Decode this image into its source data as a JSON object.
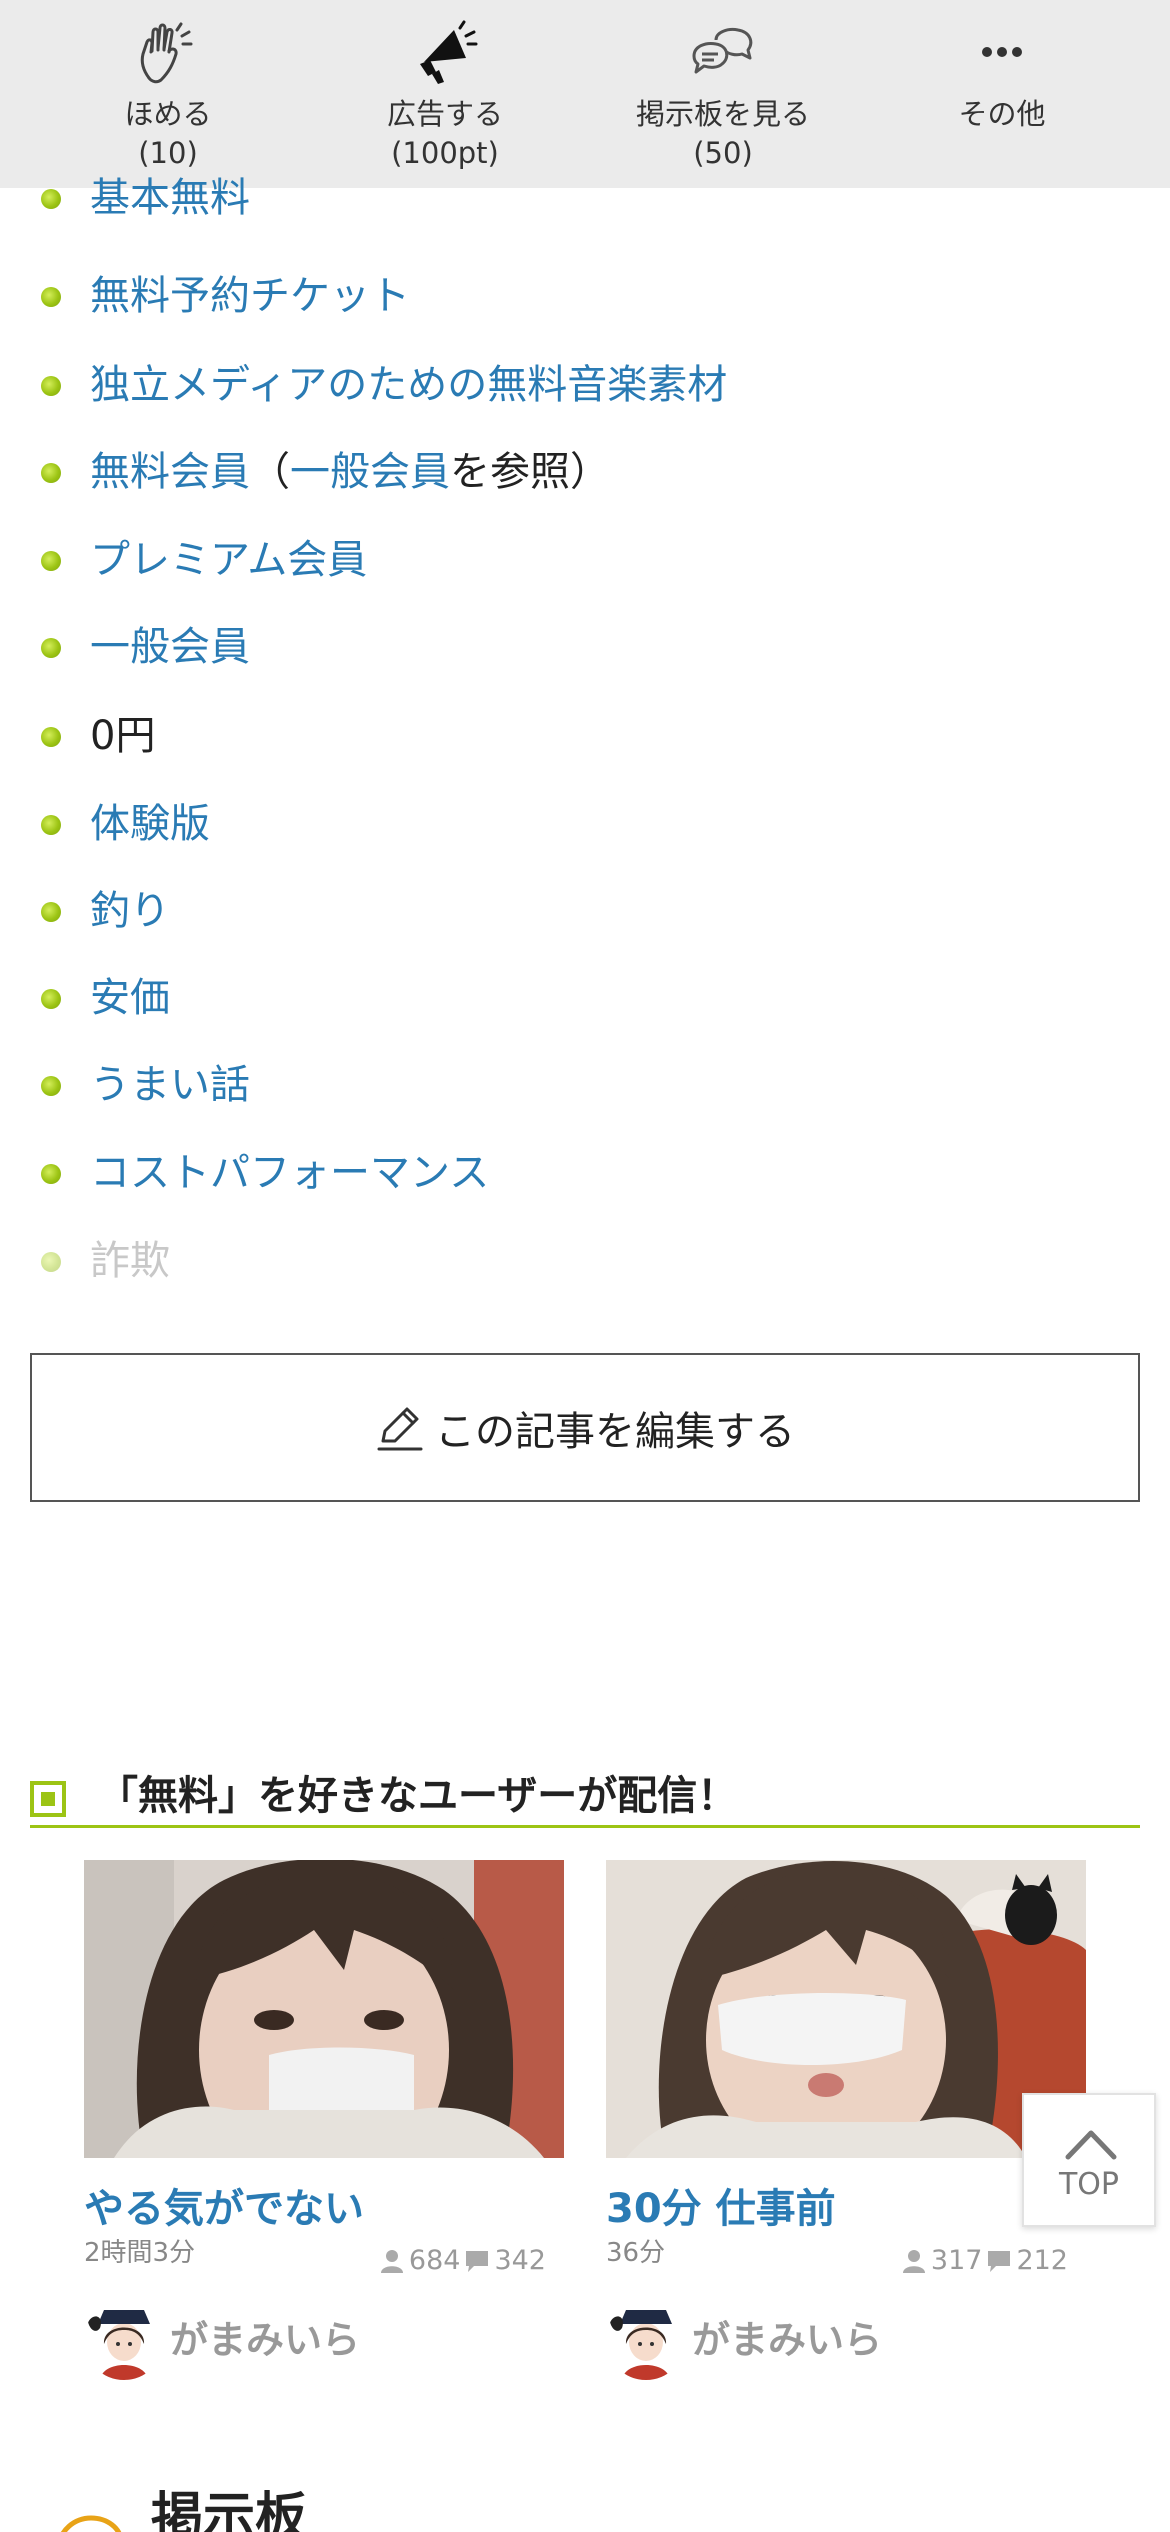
{
  "toolbar": {
    "items": [
      {
        "label": "ほめる",
        "count": "(10)",
        "icon": "clap-icon"
      },
      {
        "label": "広告する",
        "count": "(100pt)",
        "icon": "megaphone-icon"
      },
      {
        "label": "掲示板を見る",
        "count": "(50)",
        "icon": "chat-bubbles-icon"
      },
      {
        "label": "その他",
        "count": "",
        "icon": "more-icon"
      }
    ]
  },
  "related": {
    "items": [
      {
        "parts": [
          {
            "text": "基本無料",
            "link": true
          }
        ]
      },
      {
        "parts": [
          {
            "text": "無料予約チケット",
            "link": true
          }
        ]
      },
      {
        "parts": [
          {
            "text": "独立メディアのための無料音楽素材",
            "link": true
          }
        ]
      },
      {
        "parts": [
          {
            "text": "無料会員",
            "link": true
          },
          {
            "text": "（",
            "link": false
          },
          {
            "text": "一般会員",
            "link": true
          },
          {
            "text": "を参照）",
            "link": false
          }
        ]
      },
      {
        "parts": [
          {
            "text": "プレミアム会員",
            "link": true
          }
        ]
      },
      {
        "parts": [
          {
            "text": "一般会員",
            "link": true
          }
        ]
      },
      {
        "parts": [
          {
            "text": "0円",
            "link": false
          }
        ]
      },
      {
        "parts": [
          {
            "text": "体験版",
            "link": true
          }
        ]
      },
      {
        "parts": [
          {
            "text": "釣り",
            "link": true
          }
        ]
      },
      {
        "parts": [
          {
            "text": "安価",
            "link": true
          }
        ]
      },
      {
        "parts": [
          {
            "text": "うまい話",
            "link": true
          }
        ]
      },
      {
        "parts": [
          {
            "text": "コストパフォーマンス",
            "link": true
          }
        ]
      },
      {
        "parts": [
          {
            "text": "詐欺",
            "link": false,
            "faded": true
          }
        ]
      }
    ]
  },
  "edit_button": {
    "label": "この記事を編集する"
  },
  "section": {
    "title": "「無料」を好きなユーザーが配信！"
  },
  "cards": [
    {
      "title": "やる気がでない",
      "duration": "2時間3分",
      "viewers": "684",
      "comments": "342",
      "user": "がまみいら"
    },
    {
      "title": "30分 仕事前",
      "duration": "36分",
      "viewers": "317",
      "comments": "212",
      "user": "がまみいら"
    }
  ],
  "top_button": {
    "label": "TOP"
  },
  "board": {
    "title": "掲示板"
  },
  "colors": {
    "link": "#2a7bb4",
    "accent": "#9cc414",
    "toolbar_bg": "#ebebeb"
  }
}
